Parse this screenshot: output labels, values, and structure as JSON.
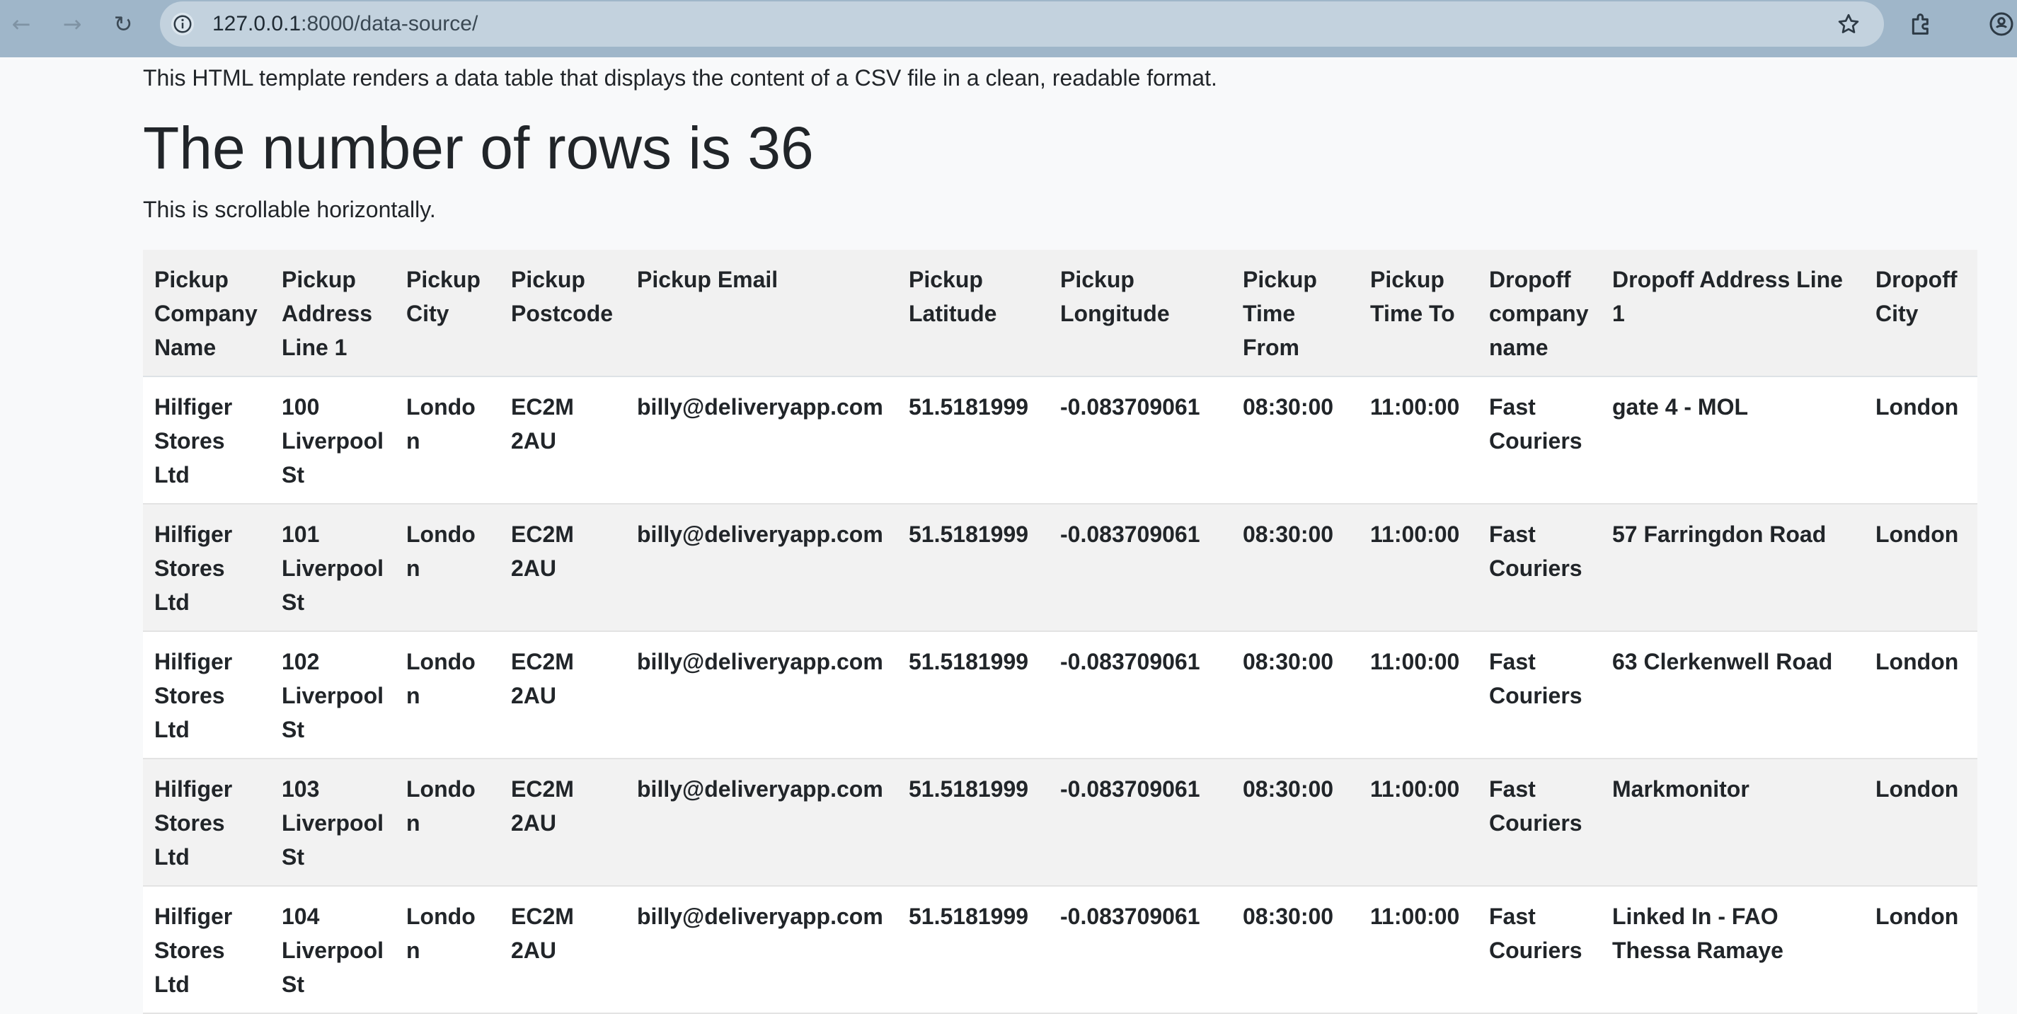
{
  "browser": {
    "url_host": "127.0.0.1",
    "url_rest": ":8000/data-source/",
    "icons": [
      "back-icon",
      "forward-icon",
      "reload-icon",
      "site-info-icon",
      "bookmark-star-icon",
      "extensions-icon",
      "profile-icon"
    ]
  },
  "page": {
    "intro": "This HTML template renders a data table that displays the content of a CSV file in a clean, readable format.",
    "heading": "The number of rows is 36",
    "note": "This is scrollable horizontally."
  },
  "table": {
    "headers": [
      "Pickup Company Name",
      "Pickup Address Line 1",
      "Pickup City",
      "Pickup Postcode",
      "Pickup Email",
      "Pickup Latitude",
      "Pickup Longitude",
      "Pickup Time From",
      "Pickup Time To",
      "Dropoff company name",
      "Dropoff Address Line 1",
      "Dropoff City"
    ],
    "rows": [
      [
        "Hilfiger Stores Ltd",
        "100 Liverpool St",
        "London",
        "EC2M 2AU",
        "billy@deliveryapp.com",
        "51.5181999",
        "-0.083709061",
        "08:30:00",
        "11:00:00",
        "Fast Couriers",
        "gate 4 - MOL",
        "London"
      ],
      [
        "Hilfiger Stores Ltd",
        "101 Liverpool St",
        "London",
        "EC2M 2AU",
        "billy@deliveryapp.com",
        "51.5181999",
        "-0.083709061",
        "08:30:00",
        "11:00:00",
        "Fast Couriers",
        "57 Farringdon Road",
        "London"
      ],
      [
        "Hilfiger Stores Ltd",
        "102 Liverpool St",
        "London",
        "EC2M 2AU",
        "billy@deliveryapp.com",
        "51.5181999",
        "-0.083709061",
        "08:30:00",
        "11:00:00",
        "Fast Couriers",
        "63 Clerkenwell Road",
        "London"
      ],
      [
        "Hilfiger Stores Ltd",
        "103 Liverpool St",
        "London",
        "EC2M 2AU",
        "billy@deliveryapp.com",
        "51.5181999",
        "-0.083709061",
        "08:30:00",
        "11:00:00",
        "Fast Couriers",
        "Markmonitor",
        "London"
      ],
      [
        "Hilfiger Stores Ltd",
        "104 Liverpool St",
        "London",
        "EC2M 2AU",
        "billy@deliveryapp.com",
        "51.5181999",
        "-0.083709061",
        "08:30:00",
        "11:00:00",
        "Fast Couriers",
        "Linked In - FAO Thessa Ramaye",
        "London"
      ]
    ]
  }
}
